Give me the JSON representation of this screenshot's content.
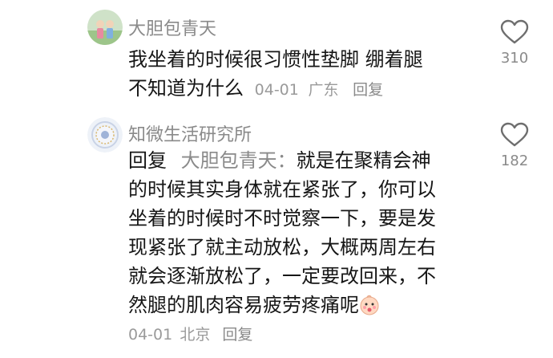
{
  "comments": [
    {
      "username": "大胆包青天",
      "line1": "我坐着的时候很习惯性垫脚 绷着腿",
      "line2": "不知道为什么",
      "date": "04-01",
      "location": "广东",
      "reply_label": "回复",
      "likes": "310"
    },
    {
      "username": "知微生活研究所",
      "reply_prefix": "回复",
      "reply_target": "大胆包青天：",
      "line1_rest": "就是在聚精会神",
      "lines": [
        "的时候其实身体就在紧张了，你可以",
        "坐着的时候时不时觉察一下，要是发",
        "现紧张了就主动放松，大概两周左右",
        "就会逐渐放松了，一定要改回来，不"
      ],
      "last_line": "然腿的肌肉容易疲劳疼痛呢",
      "emoji": "baby-face-emoji",
      "date": "04-01",
      "location": "北京",
      "reply_label": "回复",
      "likes": "182"
    }
  ]
}
